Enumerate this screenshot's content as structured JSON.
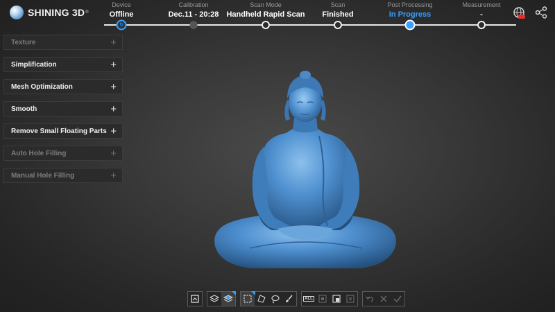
{
  "app": {
    "brand": "SHINING 3D",
    "trademark": "®"
  },
  "workflow": {
    "steps": [
      {
        "label": "Device",
        "value": "Offline",
        "state": "device"
      },
      {
        "label": "Calibration",
        "value": "Dec.11 - 20:28",
        "state": "dim"
      },
      {
        "label": "Scan Mode",
        "value": "Handheld Rapid Scan",
        "state": "done"
      },
      {
        "label": "Scan",
        "value": "Finished",
        "state": "done"
      },
      {
        "label": "Post Processing",
        "value": "In Progress",
        "state": "active"
      },
      {
        "label": "Measurement",
        "value": "-",
        "state": "pending"
      }
    ]
  },
  "header_icons": [
    "globe-help-icon",
    "share-icon"
  ],
  "left_panel": {
    "items": [
      {
        "label": "Texture",
        "enabled": false
      },
      {
        "label": "Simplification",
        "enabled": true
      },
      {
        "label": "Mesh Optimization",
        "enabled": true
      },
      {
        "label": "Smooth",
        "enabled": true
      },
      {
        "label": "Remove Small Floating Parts",
        "enabled": true
      },
      {
        "label": "Auto Hole Filling",
        "enabled": false
      },
      {
        "label": "Manual Hole Filling",
        "enabled": false
      }
    ],
    "expand_glyph": "+"
  },
  "toolbar": {
    "groups": [
      [
        "home-view-icon"
      ],
      [
        "layers-icon",
        "layers-selected-icon"
      ],
      [
        "rect-select-icon",
        "polygon-select-icon",
        "lasso-select-icon",
        "brush-select-icon"
      ],
      [
        "select-all-icon",
        "invert-select-icon",
        "select-connected-icon",
        "delete-icon"
      ],
      [
        "undo-icon",
        "cancel-icon",
        "apply-icon"
      ]
    ],
    "select_all_text": "ALL"
  },
  "colors": {
    "accent": "#3aa0ff",
    "model": "#4e8fcf"
  }
}
